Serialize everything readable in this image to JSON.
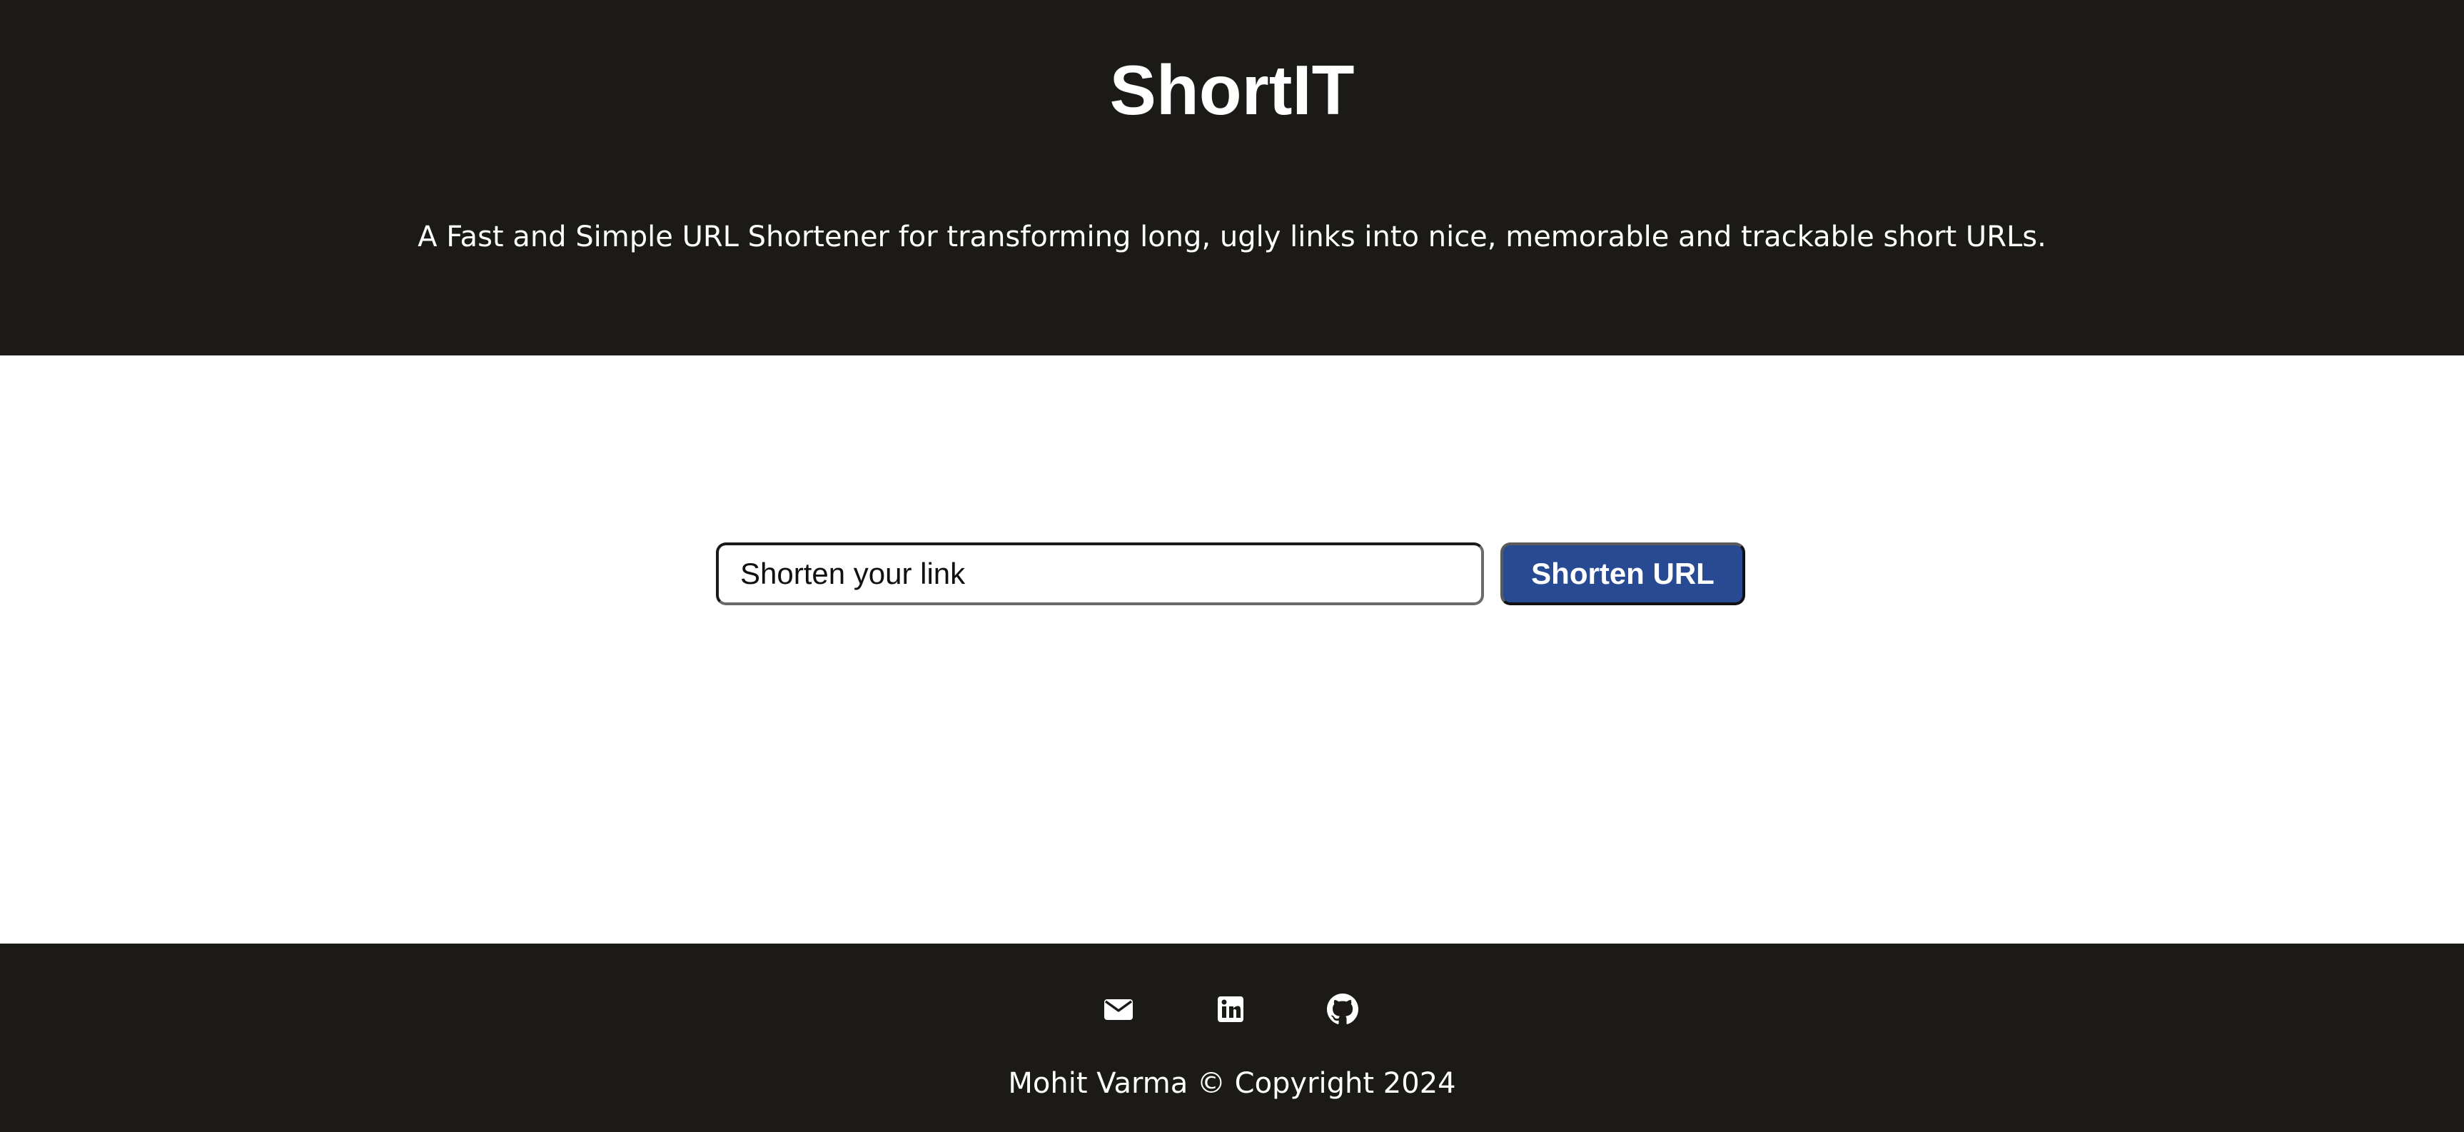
{
  "header": {
    "title": "ShortIT",
    "tagline": "A Fast and Simple URL Shortener for transforming long, ugly links into nice, memorable and trackable short URLs."
  },
  "form": {
    "input_placeholder": "Shorten your link",
    "input_value": "",
    "button_label": "Shorten URL"
  },
  "footer": {
    "social_links": [
      {
        "icon": "envelope-icon",
        "label": "Email"
      },
      {
        "icon": "linkedin-icon",
        "label": "LinkedIn"
      },
      {
        "icon": "github-icon",
        "label": "GitHub"
      }
    ],
    "copyright": "Mohit Varma © Copyright 2024"
  },
  "colors": {
    "header_background": "#1c1a17",
    "footer_background": "#1c1a17",
    "button_background": "#284a93",
    "text_light": "#ffffff"
  }
}
